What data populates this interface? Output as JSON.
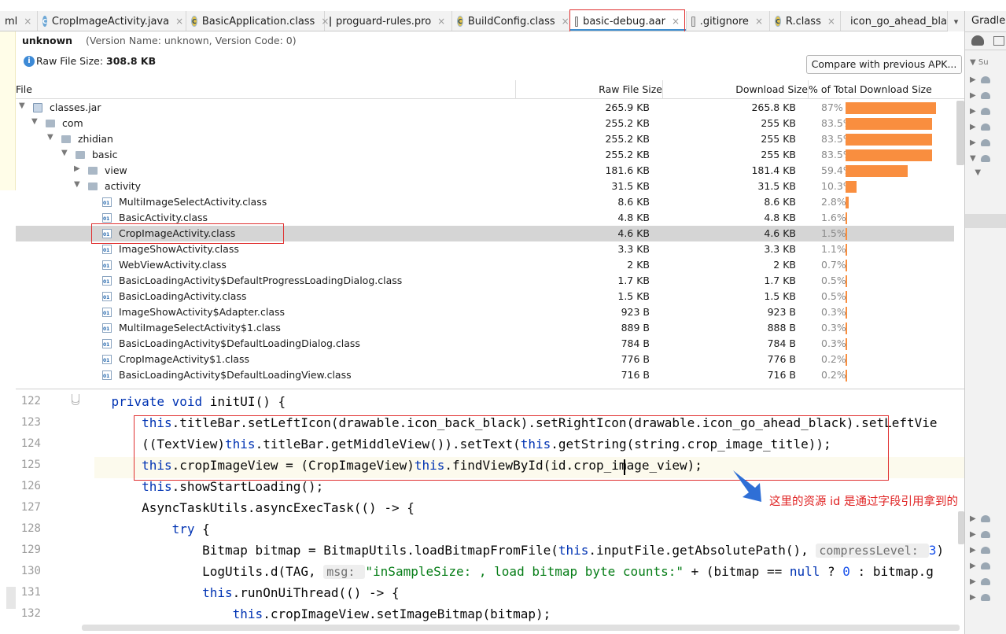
{
  "tabs": [
    {
      "label": "ml",
      "icon": "none"
    },
    {
      "label": "CropImageActivity.java",
      "icon": "java-class-icon"
    },
    {
      "label": "BasicApplication.class",
      "icon": "class-file-icon"
    },
    {
      "label": "proguard-rules.pro",
      "icon": "text-file-icon"
    },
    {
      "label": "BuildConfig.class",
      "icon": "class-file-icon"
    },
    {
      "label": "basic-debug.aar",
      "icon": "archive-icon"
    },
    {
      "label": ".gitignore",
      "icon": "git-file-icon"
    },
    {
      "label": "R.class",
      "icon": "class-file-icon"
    },
    {
      "label": "icon_go_ahead_bla",
      "icon": "image-file-icon"
    }
  ],
  "right_panel": {
    "title": "Gradle",
    "tree_label": "Su"
  },
  "apk": {
    "app_name": "unknown",
    "version_info": "(Version Name: unknown, Version Code: 0)",
    "raw_size_label": "Raw File Size: ",
    "raw_size_value": "308.8 KB",
    "compare_button": "Compare with previous APK..."
  },
  "table": {
    "headers": {
      "file": "File",
      "raw": "Raw File Size",
      "download": "Download Size",
      "percent": "% of Total Download Size"
    },
    "rows": [
      {
        "name": "classes.jar",
        "raw": "265.9 KB",
        "dl": "265.8 KB",
        "pct": "87%",
        "fraction": 0.87,
        "depth": 0,
        "arrow": "▼",
        "icon": "jar"
      },
      {
        "name": "com",
        "raw": "255.2 KB",
        "dl": "255 KB",
        "pct": "83.5%",
        "fraction": 0.835,
        "depth": 1,
        "arrow": "▼",
        "icon": "folder"
      },
      {
        "name": "zhidian",
        "raw": "255.2 KB",
        "dl": "255 KB",
        "pct": "83.5%",
        "fraction": 0.835,
        "depth": 2,
        "arrow": "▼",
        "icon": "folder"
      },
      {
        "name": "basic",
        "raw": "255.2 KB",
        "dl": "255 KB",
        "pct": "83.5%",
        "fraction": 0.835,
        "depth": 3,
        "arrow": "▼",
        "icon": "folder"
      },
      {
        "name": "view",
        "raw": "181.6 KB",
        "dl": "181.4 KB",
        "pct": "59.4%",
        "fraction": 0.594,
        "depth": 4,
        "arrow": "▶",
        "icon": "folder"
      },
      {
        "name": "activity",
        "raw": "31.5 KB",
        "dl": "31.5 KB",
        "pct": "10.3%",
        "fraction": 0.103,
        "depth": 4,
        "arrow": "▼",
        "icon": "folder"
      },
      {
        "name": "MultiImageSelectActivity.class",
        "raw": "8.6 KB",
        "dl": "8.6 KB",
        "pct": "2.8%",
        "fraction": 0.028,
        "depth": 5,
        "arrow": "",
        "icon": "class"
      },
      {
        "name": "BasicActivity.class",
        "raw": "4.8 KB",
        "dl": "4.8 KB",
        "pct": "1.6%",
        "fraction": 0.016,
        "depth": 5,
        "arrow": "",
        "icon": "class"
      },
      {
        "name": "CropImageActivity.class",
        "raw": "4.6 KB",
        "dl": "4.6 KB",
        "pct": "1.5%",
        "fraction": 0.015,
        "depth": 5,
        "arrow": "",
        "icon": "class",
        "selected": true
      },
      {
        "name": "ImageShowActivity.class",
        "raw": "3.3 KB",
        "dl": "3.3 KB",
        "pct": "1.1%",
        "fraction": 0.011,
        "depth": 5,
        "arrow": "",
        "icon": "class"
      },
      {
        "name": "WebViewActivity.class",
        "raw": "2 KB",
        "dl": "2 KB",
        "pct": "0.7%",
        "fraction": 0.007,
        "depth": 5,
        "arrow": "",
        "icon": "class"
      },
      {
        "name": "BasicLoadingActivity$DefaultProgressLoadingDialog.class",
        "raw": "1.7 KB",
        "dl": "1.7 KB",
        "pct": "0.5%",
        "fraction": 0.005,
        "depth": 5,
        "arrow": "",
        "icon": "class"
      },
      {
        "name": "BasicLoadingActivity.class",
        "raw": "1.5 KB",
        "dl": "1.5 KB",
        "pct": "0.5%",
        "fraction": 0.005,
        "depth": 5,
        "arrow": "",
        "icon": "class"
      },
      {
        "name": "ImageShowActivity$Adapter.class",
        "raw": "923 B",
        "dl": "923 B",
        "pct": "0.3%",
        "fraction": 0.003,
        "depth": 5,
        "arrow": "",
        "icon": "class"
      },
      {
        "name": "MultiImageSelectActivity$1.class",
        "raw": "889 B",
        "dl": "888 B",
        "pct": "0.3%",
        "fraction": 0.003,
        "depth": 5,
        "arrow": "",
        "icon": "class"
      },
      {
        "name": "BasicLoadingActivity$DefaultLoadingDialog.class",
        "raw": "784 B",
        "dl": "784 B",
        "pct": "0.3%",
        "fraction": 0.003,
        "depth": 5,
        "arrow": "",
        "icon": "class"
      },
      {
        "name": "CropImageActivity$1.class",
        "raw": "776 B",
        "dl": "776 B",
        "pct": "0.2%",
        "fraction": 0.002,
        "depth": 5,
        "arrow": "",
        "icon": "class"
      },
      {
        "name": "BasicLoadingActivity$DefaultLoadingView.class",
        "raw": "716 B",
        "dl": "716 B",
        "pct": "0.2%",
        "fraction": 0.002,
        "depth": 5,
        "arrow": "",
        "icon": "class"
      }
    ]
  },
  "editor": {
    "line_numbers": [
      "122",
      "123",
      "124",
      "125",
      "126",
      "127",
      "128",
      "129",
      "130",
      "131",
      "132"
    ],
    "lines": [
      [
        {
          "t": "    "
        },
        {
          "t": "private ",
          "c": "kw"
        },
        {
          "t": "void ",
          "c": "kw"
        },
        {
          "t": "initUI() {"
        }
      ],
      [
        {
          "t": "        "
        },
        {
          "t": "this",
          "c": "kw"
        },
        {
          "t": ".titleBar.setLeftIcon(drawable.icon_back_black).setRightIcon(drawable.icon_go_ahead_black).setLeftVie"
        }
      ],
      [
        {
          "t": "        ((TextView)"
        },
        {
          "t": "this",
          "c": "kw"
        },
        {
          "t": ".titleBar.getMiddleView()).setText("
        },
        {
          "t": "this",
          "c": "kw"
        },
        {
          "t": ".getString(string.crop_image_title));"
        }
      ],
      [
        {
          "t": "        "
        },
        {
          "t": "this",
          "c": "kw"
        },
        {
          "t": ".cropImageView = (CropImageView)"
        },
        {
          "t": "this",
          "c": "kw"
        },
        {
          "t": ".findViewById(id.crop_image_view);"
        }
      ],
      [
        {
          "t": "        "
        },
        {
          "t": "this",
          "c": "kw"
        },
        {
          "t": ".showStartLoading();"
        }
      ],
      [
        {
          "t": "        AsyncTaskUtils.asyncExecTask(() -> {"
        }
      ],
      [
        {
          "t": "            "
        },
        {
          "t": "try ",
          "c": "kw"
        },
        {
          "t": "{"
        }
      ],
      [
        {
          "t": "                Bitmap bitmap = BitmapUtils.loadBitmapFromFile("
        },
        {
          "t": "this",
          "c": "kw"
        },
        {
          "t": ".inputFile.getAbsolutePath(), "
        },
        {
          "t": "compressLevel: ",
          "c": "hint"
        },
        {
          "t": "3",
          "c": "num"
        },
        {
          "t": ")"
        }
      ],
      [
        {
          "t": "                LogUtils.d(TAG, "
        },
        {
          "t": "msg: ",
          "c": "hint"
        },
        {
          "t": "\"inSampleSize: , load bitmap byte counts:\"",
          "c": "str"
        },
        {
          "t": " + (bitmap == "
        },
        {
          "t": "null",
          "c": "kw"
        },
        {
          "t": " ? "
        },
        {
          "t": "0",
          "c": "num"
        },
        {
          "t": " : bitmap.g"
        }
      ],
      [
        {
          "t": "                "
        },
        {
          "t": "this",
          "c": "kw"
        },
        {
          "t": ".runOnUiThread(() -> {"
        }
      ],
      [
        {
          "t": "                    "
        },
        {
          "t": "this",
          "c": "kw"
        },
        {
          "t": ".cropImageView.setImageBitmap(bitmap);"
        }
      ]
    ]
  },
  "annotation": {
    "text": "这里的资源 id 是通过字段引用拿到的",
    "color": "#e02424"
  },
  "colors": {
    "bar": "#f98e3f",
    "highlight_box": "#e03030",
    "selection": "#d5d5d5"
  }
}
